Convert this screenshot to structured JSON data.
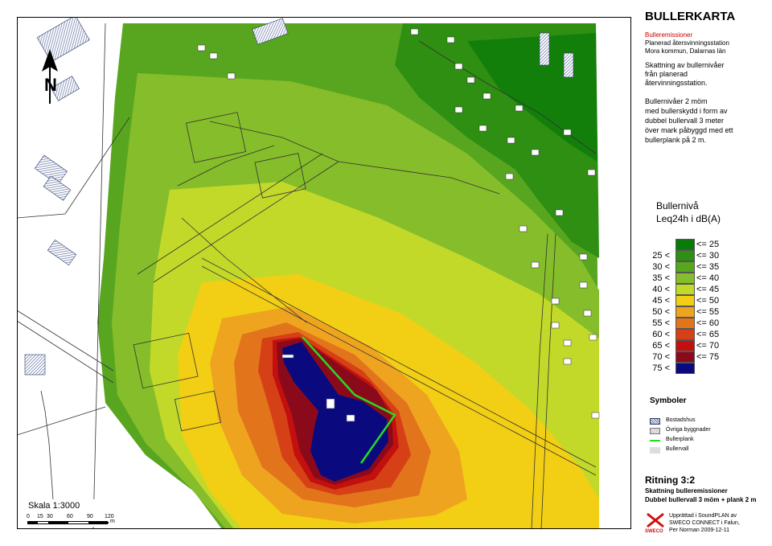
{
  "title": "BULLERKARTA",
  "subtitle_lines": [
    "Bulleremissioner",
    "Planerad återsvinningsstation",
    "Mora kommun, Dalarnas län"
  ],
  "description1_lines": [
    "Skattning av bullernivåer",
    "från planerad",
    "återvinningsstation."
  ],
  "description2_lines": [
    "Bullernivåer 2 möm",
    "med bullerskydd i form av",
    "dubbel bullervall 3 meter",
    "över mark påbyggd med ett",
    "bullerplank på 2 m."
  ],
  "legend": {
    "title_line1": "Bullernivå",
    "title_line2": "Leq24h i dB(A)",
    "classes": [
      {
        "lo": "",
        "hi": "<= 25",
        "color": "#0a7a0a"
      },
      {
        "lo": "25 <",
        "hi": "<= 30",
        "color": "#2e8f12"
      },
      {
        "lo": "30 <",
        "hi": "<= 35",
        "color": "#58a620"
      },
      {
        "lo": "35 <",
        "hi": "<= 40",
        "color": "#86bd2a"
      },
      {
        "lo": "40 <",
        "hi": "<= 45",
        "color": "#c2d92a"
      },
      {
        "lo": "45 <",
        "hi": "<= 50",
        "color": "#f2cf14"
      },
      {
        "lo": "50 <",
        "hi": "<= 55",
        "color": "#efa420"
      },
      {
        "lo": "55 <",
        "hi": "<= 60",
        "color": "#e2741c"
      },
      {
        "lo": "60 <",
        "hi": "<= 65",
        "color": "#d64016"
      },
      {
        "lo": "65 <",
        "hi": "<= 70",
        "color": "#c2100e"
      },
      {
        "lo": "70 <",
        "hi": "<= 75",
        "color": "#8a0a1c"
      },
      {
        "lo": "75 <",
        "hi": "",
        "color": "#0a0a7e"
      }
    ]
  },
  "symbols": {
    "title": "Symboler",
    "items": [
      {
        "label": "Bostadshus",
        "kind": "hatch"
      },
      {
        "label": "Övriga byggnader",
        "kind": "hatch-light"
      },
      {
        "label": "Bullerplank",
        "kind": "green-line",
        "color": "#22dd22"
      },
      {
        "label": "Bullervall",
        "kind": "grey",
        "color": "#dddddd"
      }
    ]
  },
  "drawing": {
    "title": "Ritning 3:2",
    "line1": "Skattning bulleremissioner",
    "line2": "Dubbel bullervall 3 möm + plank 2 m"
  },
  "credit_lines": [
    "Upprättad i SoundPLAN av",
    "SWECO CONNECT i Falun,",
    "Per Norman 2009-12-11"
  ],
  "logo_text": "SWECO",
  "scale": {
    "label": "Skala 1:3000",
    "ticks": [
      "0",
      "15",
      "30",
      "60",
      "90",
      "120"
    ],
    "unit": "m"
  },
  "north_letter": "N"
}
